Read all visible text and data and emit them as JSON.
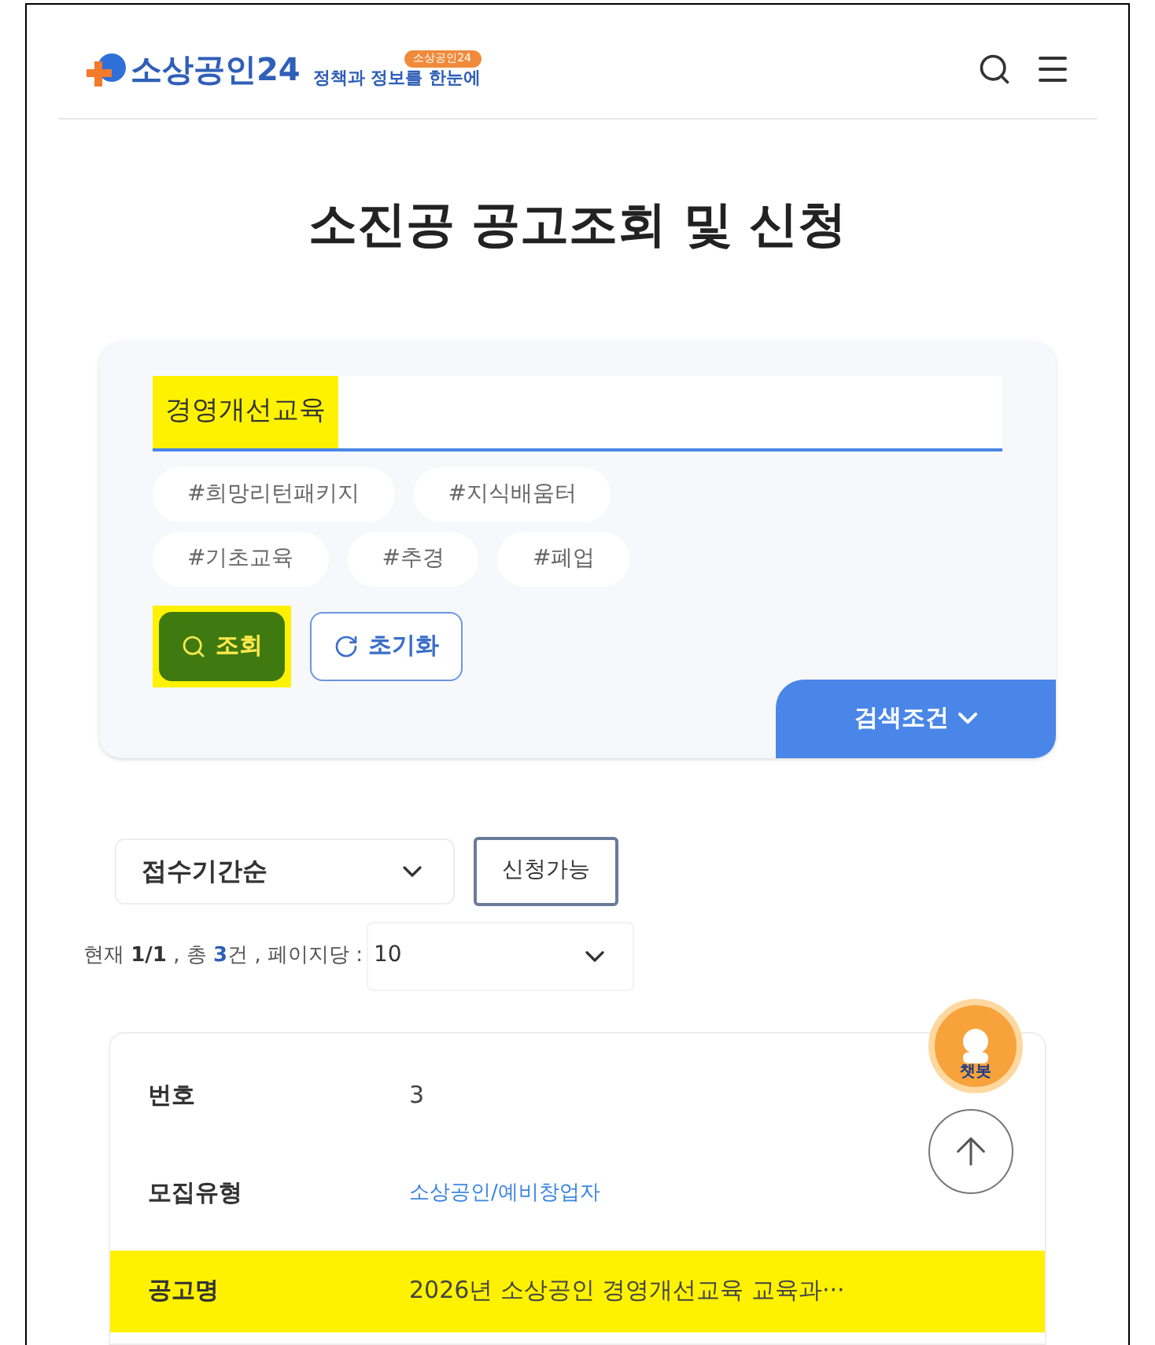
{
  "header": {
    "logo_text": "소상공인24",
    "badge": "소상공인24",
    "tagline": "정책과 정보를 한눈에"
  },
  "title": "소진공 공고조회 및 신청",
  "search": {
    "value": "경영개선교육",
    "highlighted": true
  },
  "tags": [
    [
      "#희망리턴패키지",
      "#지식배움터"
    ],
    [
      "#기초교육",
      "#추경",
      "#폐업"
    ]
  ],
  "buttons": [
    {
      "kind": "search",
      "label": "조회",
      "highlighted": true
    },
    {
      "kind": "reset",
      "label": "초기화",
      "highlighted": false
    }
  ],
  "conditions_tab": {
    "label": "검색조건"
  },
  "sort": {
    "value": "접수기간순"
  },
  "filter_button": {
    "label": "신청가능"
  },
  "count": {
    "prefix": "현재",
    "page": "1/1",
    "sep": ", 총",
    "total": "3",
    "unit": "건 , 페이지당 :"
  },
  "per_page": {
    "value": "10"
  },
  "mascot": {
    "label": "챗봇"
  },
  "rows": [
    {
      "label": "번호",
      "value": "3",
      "kind": "plain",
      "highlighted": false
    },
    {
      "label": "모집유형",
      "value": "소상공인/예비창업자",
      "kind": "link",
      "highlighted": false
    },
    {
      "label": "공고명",
      "value": "2026년 소상공인 경영개선교육 교육과···",
      "kind": "plain",
      "highlighted": true
    }
  ]
}
